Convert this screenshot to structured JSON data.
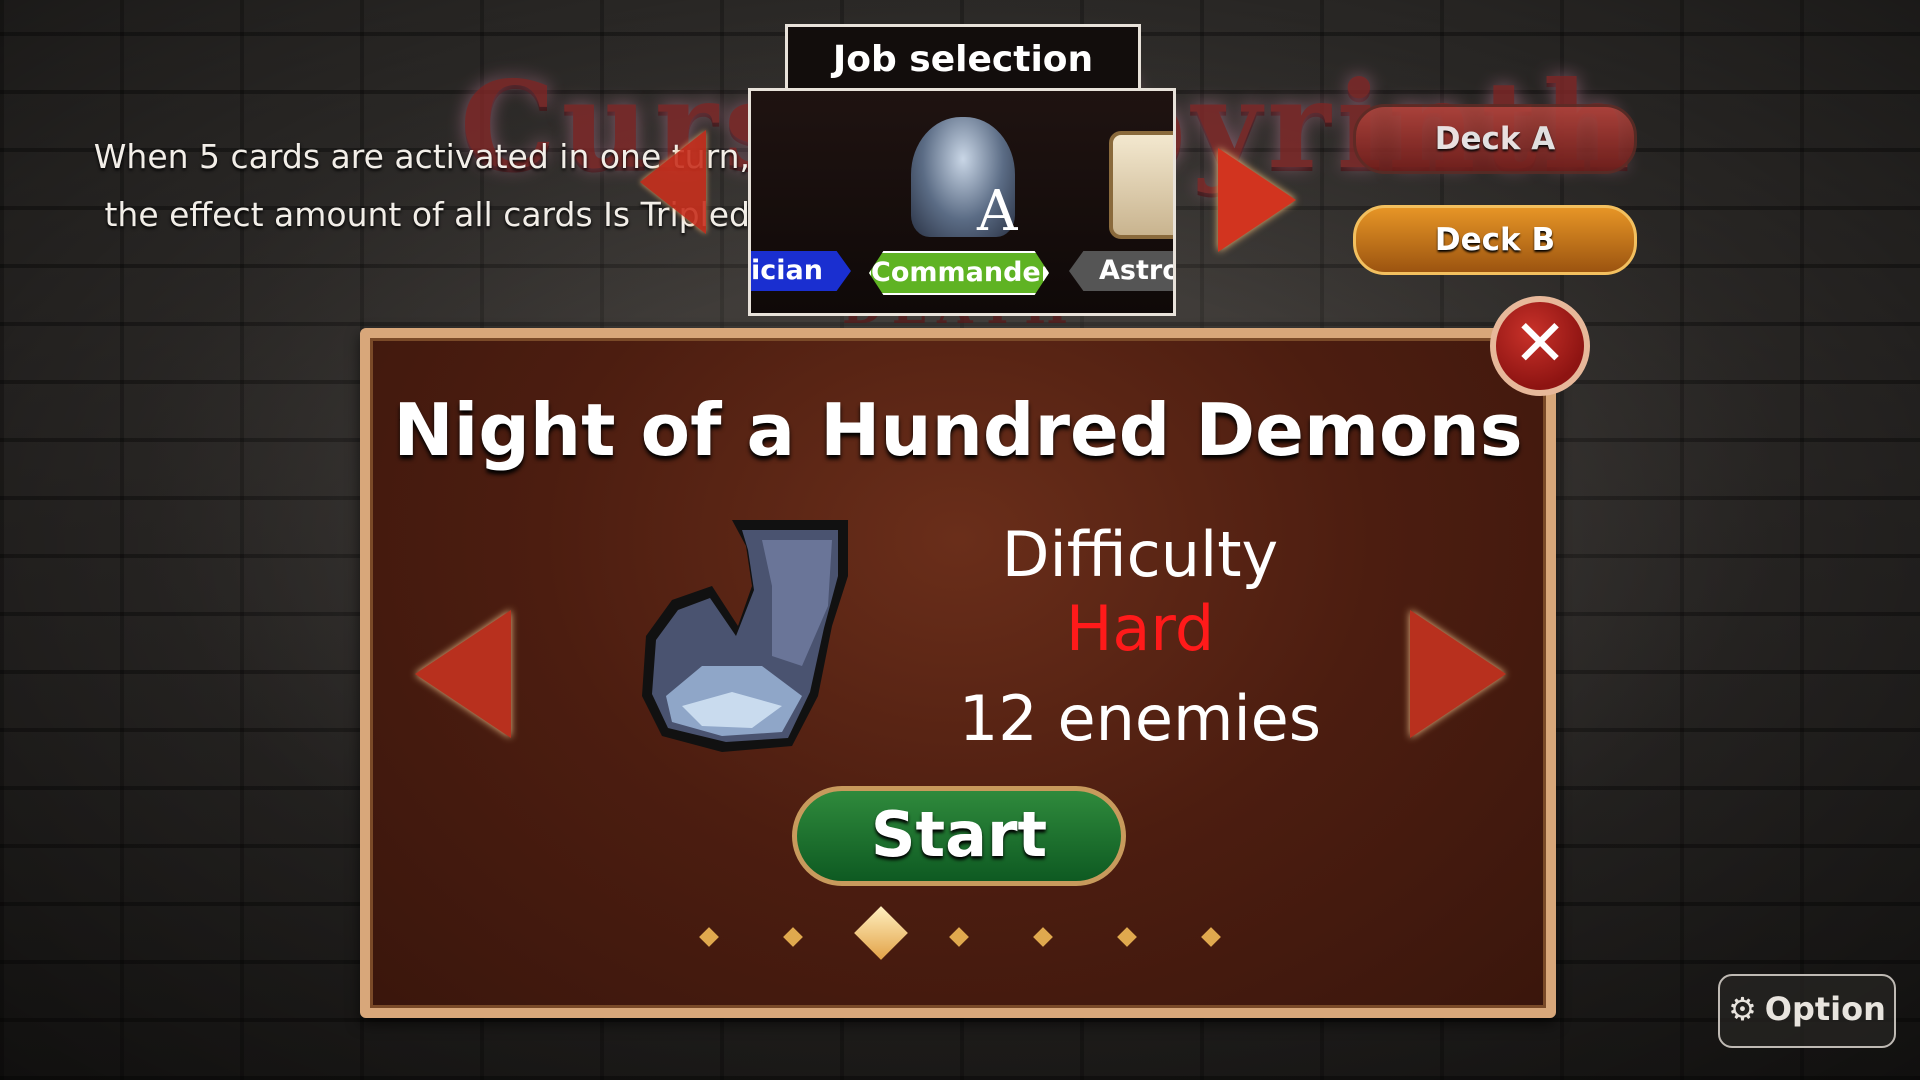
{
  "background": {
    "logo_text": "Curse Labyrinth",
    "logo_sub": "DEATH"
  },
  "bonus": {
    "line1": "When 5 cards are activated in one turn,",
    "line2": "the effect amount of all cards Is Tripled"
  },
  "job_selection": {
    "title": "Job selection",
    "jobs": [
      {
        "label": "gician",
        "icon": "staff-icon"
      },
      {
        "label": "Commander",
        "icon": "helmet-icon",
        "grade": "A"
      },
      {
        "label": "Astrolc",
        "icon": "scroll-icon"
      }
    ]
  },
  "decks": {
    "deck_a": "Deck A",
    "deck_b": "Deck B"
  },
  "stage": {
    "title": "Night of a Hundred Demons",
    "difficulty_label": "Difficulty",
    "difficulty_value": "Hard",
    "enemies": "12 enemies",
    "start_label": "Start",
    "page_count": 7,
    "active_page": 3,
    "close_icon": "✕"
  },
  "option": {
    "label": "Option",
    "icon": "gear-icon"
  },
  "colors": {
    "difficulty_hard": "#ff1a1a",
    "start_green": "#1c7a33",
    "panel_border": "#d8a77a"
  }
}
